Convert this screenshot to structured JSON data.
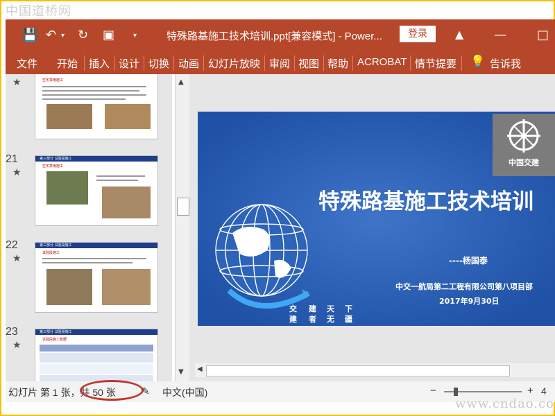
{
  "watermark_top": "中国道桥网",
  "watermark_bottom": "www.cndao.com",
  "titlebar": {
    "title": "特殊路基施工技术培训.ppt[兼容模式]  -  Power...",
    "login": "登录"
  },
  "ribbon": {
    "tabs": [
      "文件",
      "开始",
      "插入",
      "设计",
      "切换",
      "动画",
      "幻灯片放映",
      "审阅",
      "视图",
      "帮助",
      "ACROBAT",
      "情节提要",
      "告诉我"
    ]
  },
  "thumbnails": [
    {
      "num": "",
      "header": "",
      "caption": "空冬季雨施工"
    },
    {
      "num": "21",
      "header": "第三部分  试验段施工",
      "caption": "空冬季雨施工"
    },
    {
      "num": "22",
      "header": "第三部分  试验段施工",
      "caption": "试验段施工"
    },
    {
      "num": "23",
      "header": "第三部分  试验段施工",
      "caption": "试验段施工数据"
    }
  ],
  "slide": {
    "title": "特殊路基施工技术培训",
    "author": "----杨国泰",
    "org": "中交一航局第二工程有限公司第八项目部",
    "date": "2017年9月30日",
    "motto": [
      "交",
      "建",
      "天",
      "下",
      "建",
      "者",
      "无",
      "疆"
    ],
    "logo_text": "中国交建"
  },
  "status": {
    "slide_info": "幻灯片 第 1 张，共 50 张",
    "language": "中文(中国)",
    "zoom_minus": "−",
    "zoom_plus": "+",
    "zoom_tail": "4"
  },
  "colors": {
    "accent": "#b7472a",
    "slide_bg": "#1f52a6"
  }
}
